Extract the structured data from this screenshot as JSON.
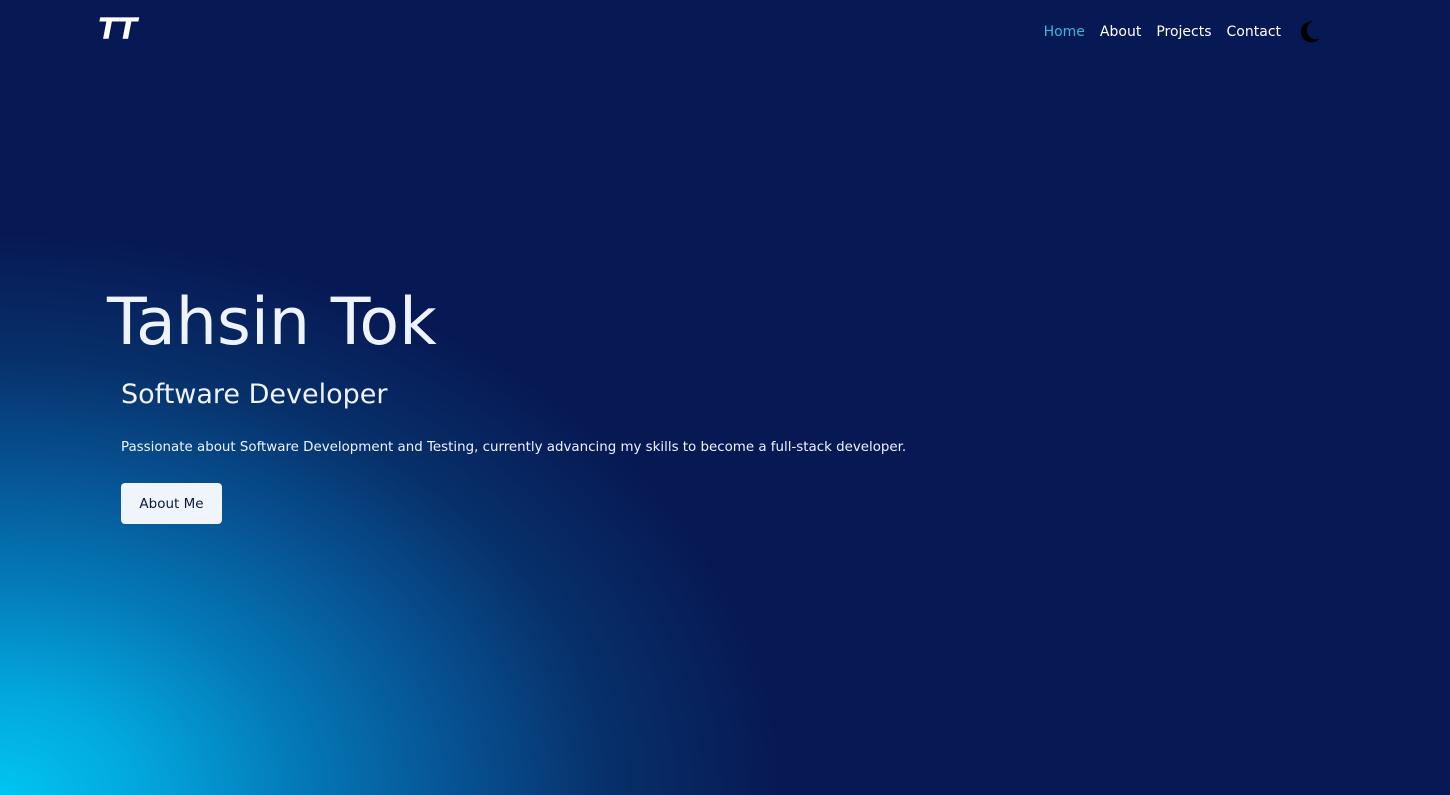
{
  "header": {
    "logo": "TT",
    "nav": [
      {
        "label": "Home",
        "active": true
      },
      {
        "label": "About",
        "active": false
      },
      {
        "label": "Projects",
        "active": false
      },
      {
        "label": "Contact",
        "active": false
      }
    ],
    "theme_toggle_icon": "moon-icon"
  },
  "hero": {
    "name": "Tahsin Tok",
    "role": "Software Developer",
    "description": "Passionate about Software Development and Testing, currently advancing my skills to become a full-stack developer.",
    "button_label": "About Me"
  },
  "colors": {
    "background": "#071954",
    "accent": "#3db4de",
    "glow": "#00c5f2",
    "text": "#eef3ff"
  }
}
